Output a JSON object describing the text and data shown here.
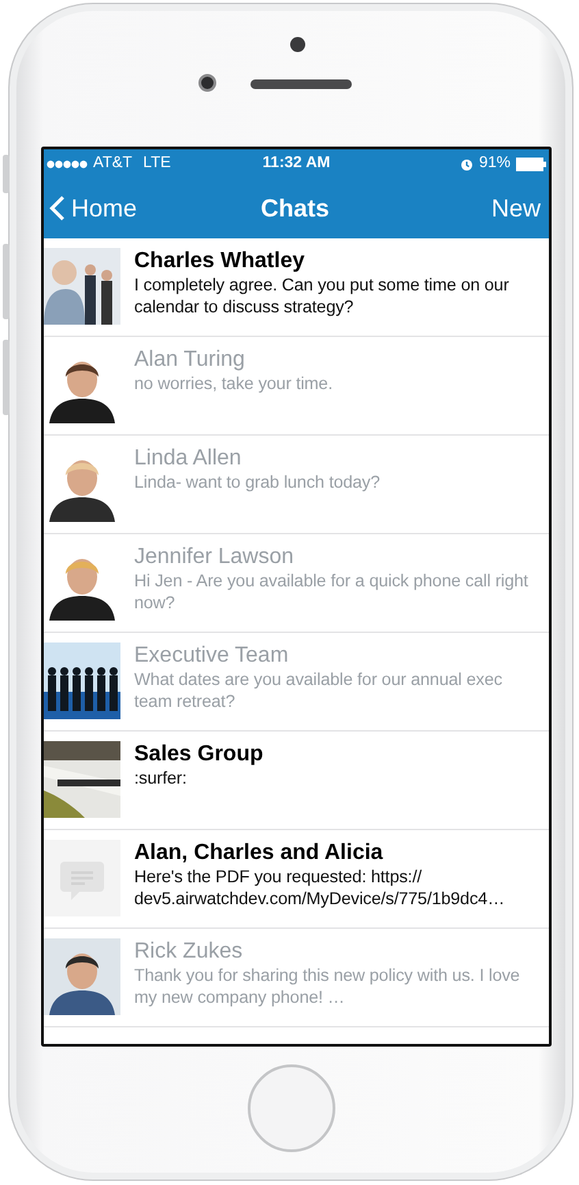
{
  "status_bar": {
    "carrier": "AT&T",
    "network": "LTE",
    "time": "11:32 AM",
    "battery": "91%"
  },
  "nav": {
    "back": "Home",
    "title": "Chats",
    "action": "New"
  },
  "chats": [
    {
      "name": "Charles Whatley",
      "message": "I completely agree. Can you put some time on our calendar to discuss strategy?",
      "unread": true
    },
    {
      "name": "Alan Turing",
      "message": "no worries, take your time.",
      "unread": false
    },
    {
      "name": "Linda Allen",
      "message": "Linda- want to grab lunch today?",
      "unread": false
    },
    {
      "name": "Jennifer Lawson",
      "message": "Hi Jen - Are you available for a quick phone call right now?",
      "unread": false
    },
    {
      "name": "Executive Team",
      "message": "What dates are you available for our annual exec team retreat?",
      "unread": false
    },
    {
      "name": "Sales Group",
      "message": ":surfer:",
      "unread": true
    },
    {
      "name": "Alan, Charles and Alicia",
      "message": "Here's the PDF you requested: https:// dev5.airwatchdev.com/MyDevice/s/775/1b9dc4…",
      "unread": true,
      "avatar": {
        "kind": "placeholder"
      }
    },
    {
      "name": "Rick Zukes",
      "message": "Thank you for sharing this new policy with us. I love my new company phone! …",
      "unread": false
    }
  ]
}
